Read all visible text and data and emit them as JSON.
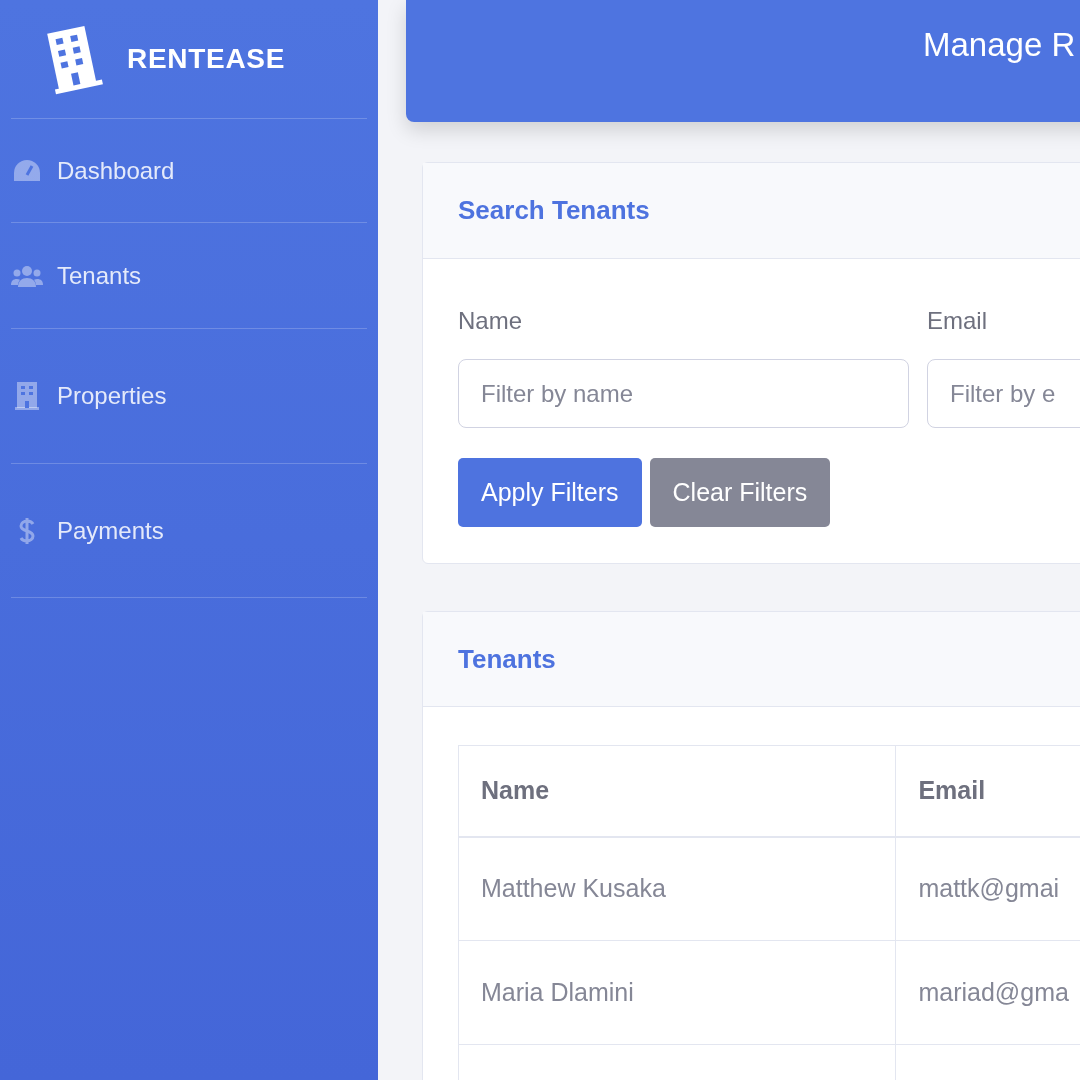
{
  "sidebar": {
    "brand": "RENTEASE",
    "items": [
      {
        "label": "Dashboard"
      },
      {
        "label": "Tenants"
      },
      {
        "label": "Properties"
      },
      {
        "label": "Payments"
      }
    ]
  },
  "header": {
    "title": "Manage R"
  },
  "search_card": {
    "title": "Search Tenants",
    "fields": [
      {
        "label": "Name",
        "placeholder": "Filter by name"
      },
      {
        "label": "Email",
        "placeholder": "Filter by e"
      }
    ],
    "buttons": [
      {
        "label": "Apply Filters",
        "kind": "primary"
      },
      {
        "label": "Clear Filters",
        "kind": "secondary"
      }
    ]
  },
  "tenants_card": {
    "title": "Tenants",
    "table": {
      "columns": [
        "Name",
        "Email"
      ],
      "rows": [
        [
          "Matthew Kusaka",
          "mattk@gmai"
        ],
        [
          "Maria Dlamini",
          "mariad@gma"
        ]
      ]
    }
  }
}
